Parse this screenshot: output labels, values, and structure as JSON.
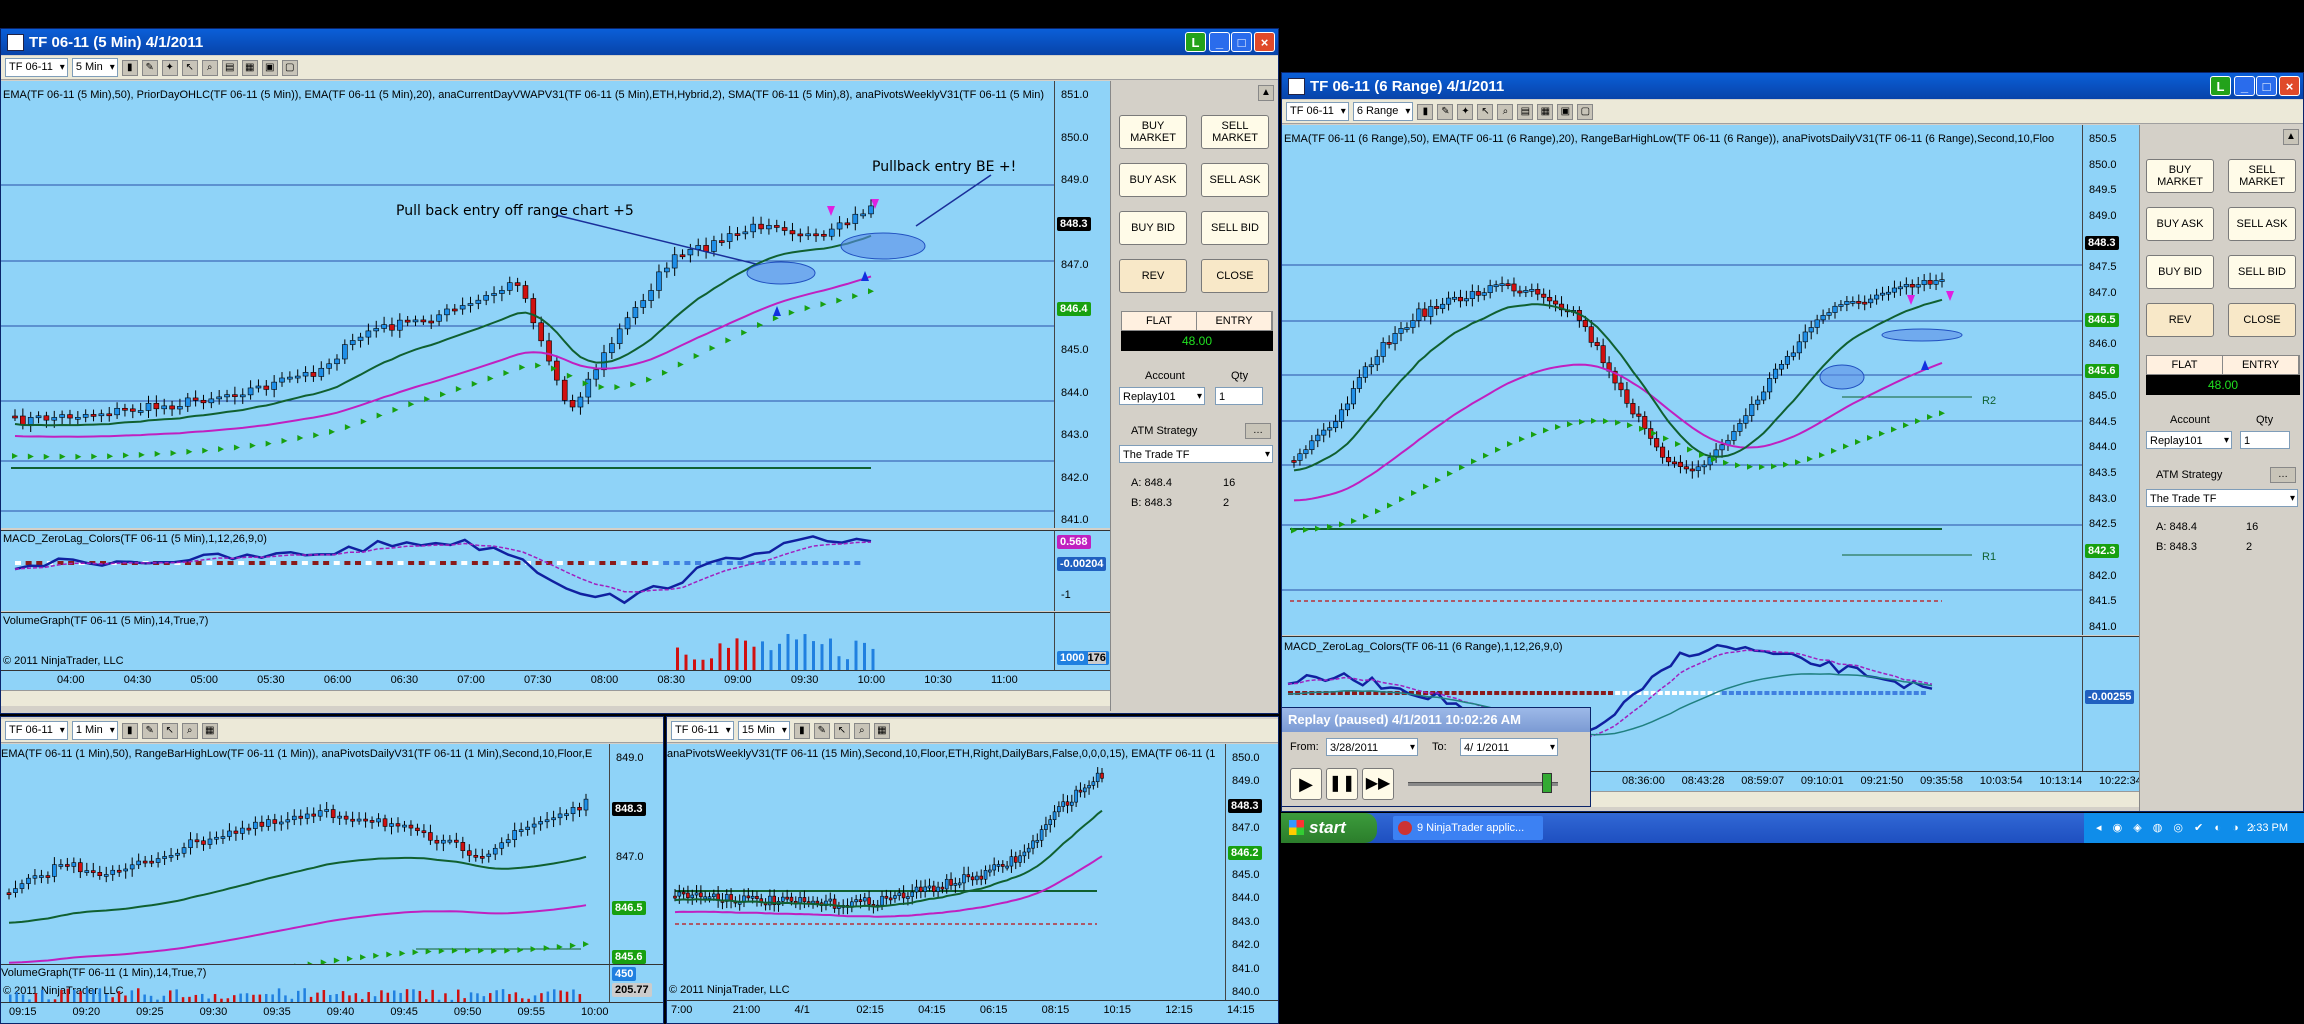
{
  "win1": {
    "title": "TF 06-11 (5 Min)  4/1/2011",
    "instrument": "TF 06-11",
    "interval": "5 Min",
    "indicator_caption": "EMA(TF 06-11 (5 Min),50), PriorDayOHLC(TF 06-11 (5 Min)), EMA(TF 06-11 (5 Min),20), anaCurrentDayVWAPV31(TF 06-11 (5 Min),ETH,Hybrid,2), SMA(TF 06-11 (5 Min),8), anaPivotsWeeklyV31(TF 06-11 (5 Min)",
    "annotation1": "Pull back entry off range chart +5",
    "annotation2": "Pullback entry BE +!",
    "macd_caption": "MACD_ZeroLag_Colors(TF 06-11 (5 Min),1,12,26,9,0)",
    "volume_caption": "VolumeGraph(TF 06-11 (5 Min),14,True,7)",
    "copyright": "© 2011 NinjaTrader, LLC",
    "yticks": [
      "851.0",
      "850.0",
      "849.0",
      "848.3",
      "847.0",
      "846.4",
      "845.0",
      "844.0",
      "843.0",
      "842.0",
      "841.0"
    ],
    "macd_ticks": [
      "0.568",
      "-0.00204",
      "-1"
    ],
    "vol_tick": "1000",
    "vol_tick2": "176",
    "xticks": [
      "04:00",
      "04:30",
      "05:00",
      "05:30",
      "06:00",
      "06:30",
      "07:00",
      "07:30",
      "08:00",
      "08:30",
      "09:00",
      "09:30",
      "10:00",
      "10:30",
      "11:00"
    ],
    "price_last": "848.3",
    "price_green": "846.4"
  },
  "order_panel": {
    "buy_market": "BUY MARKET",
    "sell_market": "SELL MARKET",
    "buy_ask": "BUY ASK",
    "sell_ask": "SELL ASK",
    "buy_bid": "BUY BID",
    "sell_bid": "SELL BID",
    "rev": "REV",
    "close": "CLOSE",
    "flat": "FLAT",
    "entry": "ENTRY",
    "pnl": "48.00",
    "account_label": "Account",
    "qty_label": "Qty",
    "account": "Replay101",
    "qty": "1",
    "atm_label": "ATM Strategy",
    "atm_value": "The Trade TF",
    "ask_label": "A: 848.4",
    "ask_size": "16",
    "bid_label": "B: 848.3",
    "bid_size": "2"
  },
  "win2": {
    "title": "TF 06-11 (6 Range)  4/1/2011",
    "instrument": "TF 06-11",
    "interval": "6 Range",
    "indicator_caption": "EMA(TF 06-11 (6 Range),50), EMA(TF 06-11 (6 Range),20), RangeBarHighLow(TF 06-11 (6 Range)), anaPivotsDailyV31(TF 06-11 (6 Range),Second,10,Floo",
    "macd_caption": "MACD_ZeroLag_Colors(TF 06-11 (6 Range),1,12,26,9,0)",
    "r2": "R2",
    "r1": "R1",
    "yticks": [
      "850.5",
      "850.0",
      "849.5",
      "849.0",
      "848.3",
      "847.5",
      "847.0",
      "846.5",
      "846.0",
      "845.6",
      "845.0",
      "844.5",
      "844.0",
      "843.5",
      "843.0",
      "842.5",
      "842.3",
      "842.0",
      "841.5",
      "841.0"
    ],
    "macd_tick": "-0.00255",
    "xticks": [
      "08:36:00",
      "08:43:28",
      "08:59:07",
      "09:10:01",
      "09:21:50",
      "09:35:58",
      "10:03:54",
      "10:13:14",
      "10:22:34"
    ],
    "price_last": "848.3",
    "price_green": "846.5",
    "price_green2": "845.6",
    "price_green3": "842.3"
  },
  "win3": {
    "instrument": "TF 06-11",
    "interval": "1 Min",
    "indicator_caption": "EMA(TF 06-11 (1 Min),50), RangeBarHighLow(TF 06-11 (1 Min)), anaPivotsDailyV31(TF 06-11 (1 Min),Second,10,Floor,E",
    "volume_caption": "VolumeGraph(TF 06-11 (1 Min),14,True,7)",
    "copyright": "© 2011 NinjaTrader, LLC",
    "yticks": [
      "849.0",
      "848.3",
      "847.0",
      "846.5",
      "845.6"
    ],
    "vol_tick": "450",
    "vol_tick2": "205.77",
    "xticks": [
      "09:15",
      "09:20",
      "09:25",
      "09:30",
      "09:35",
      "09:40",
      "09:45",
      "09:50",
      "09:55",
      "10:00"
    ]
  },
  "win4": {
    "instrument": "TF 06-11",
    "interval": "15 Min",
    "indicator_caption": "anaPivotsWeeklyV31(TF 06-11 (15 Min),Second,10,Floor,ETH,Right,DailyBars,False,0,0,0,15), EMA(TF 06-11 (1",
    "copyright": "© 2011 NinjaTrader, LLC",
    "yticks": [
      "850.0",
      "849.0",
      "848.3",
      "847.0",
      "846.2",
      "845.0",
      "844.0",
      "843.0",
      "842.0",
      "841.0",
      "840.0"
    ],
    "xticks": [
      "7:00",
      "21:00",
      "4/1",
      "02:15",
      "04:15",
      "06:15",
      "08:15",
      "10:15",
      "12:15",
      "14:15"
    ]
  },
  "replay": {
    "title": "Replay (paused) 4/1/2011 10:02:26 AM",
    "from_label": "From:",
    "from_value": "3/28/2011",
    "to_label": "To:",
    "to_value": "4/  1/2011"
  },
  "taskbar": {
    "start": "start",
    "item": "9 NinjaTrader applic...",
    "clock": "2:33 PM"
  },
  "colors": {
    "chart_bg": "#8fd3f8",
    "up_bar": "#1f8fe8",
    "down_bar": "#d01010",
    "ema50": "#c020c0",
    "ema20": "#106030",
    "pivot_green": "#18a010"
  }
}
